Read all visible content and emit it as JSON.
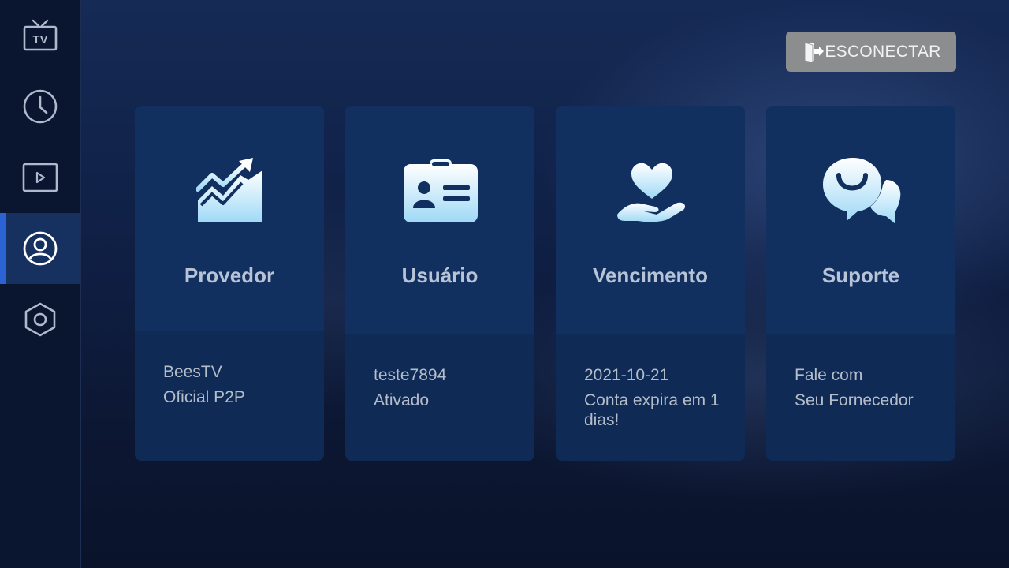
{
  "sidebar": {
    "items": [
      {
        "name": "tv",
        "icon": "tv-icon",
        "label": "TV"
      },
      {
        "name": "history",
        "icon": "clock-icon"
      },
      {
        "name": "movies",
        "icon": "play-icon"
      },
      {
        "name": "account",
        "icon": "user-circle-icon",
        "active": true
      },
      {
        "name": "settings",
        "icon": "settings-hexagon-icon"
      }
    ]
  },
  "header": {
    "disconnect_label": "ESCONECTAR",
    "disconnect_icon": "door-exit-icon"
  },
  "cards": [
    {
      "title": "Provedor",
      "icon": "trending-chart-icon",
      "line1": "BeesTV",
      "line2": "Oficial P2P"
    },
    {
      "title": "Usuário",
      "icon": "id-card-icon",
      "line1": "teste7894",
      "line2": "Ativado"
    },
    {
      "title": "Vencimento",
      "icon": "heart-hand-icon",
      "line1": "2021-10-21",
      "line2": "Conta expira em 1 dias!"
    },
    {
      "title": "Suporte",
      "icon": "chat-bubbles-icon",
      "line1": "Fale com",
      "line2": "Seu Fornecedor"
    }
  ],
  "colors": {
    "accent": "#2b63d4",
    "sidebar_bg": "#0a1630",
    "card_top": "#12305f",
    "card_bottom": "#0f2a55",
    "button_bg": "#8c8d8f"
  }
}
